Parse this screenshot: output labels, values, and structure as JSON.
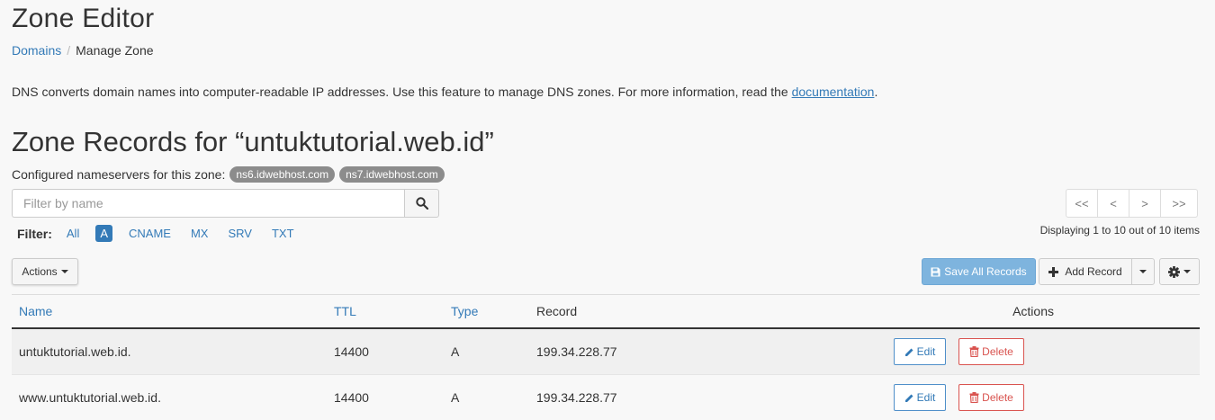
{
  "page": {
    "title": "Zone Editor",
    "breadcrumb": {
      "parent": "Domains",
      "separator": "/",
      "current": "Manage Zone"
    },
    "description": {
      "text": "DNS converts domain names into computer-readable IP addresses. Use this feature to manage DNS zones. For more information, read the ",
      "link": "documentation",
      "end": "."
    }
  },
  "zone": {
    "heading": "Zone Records for “untuktutorial.web.id”",
    "nameservers_label": "Configured nameservers for this zone:",
    "nameservers": [
      "ns6.idwebhost.com",
      "ns7.idwebhost.com"
    ]
  },
  "search": {
    "placeholder": "Filter by name",
    "icon": "search-icon"
  },
  "filter": {
    "label": "Filter:",
    "options": [
      "All",
      "A",
      "CNAME",
      "MX",
      "SRV",
      "TXT"
    ],
    "active": "A"
  },
  "pagination": {
    "buttons": [
      "<<",
      "<",
      ">",
      ">>"
    ],
    "info": "Displaying 1 to 10 out of 10 items"
  },
  "toolbar": {
    "actions_label": "Actions",
    "save_all_label": "Save All Records",
    "add_record_label": "Add Record",
    "settings_icon": "gear-icon"
  },
  "table": {
    "headers": {
      "name": "Name",
      "ttl": "TTL",
      "type": "Type",
      "record": "Record",
      "actions": "Actions"
    },
    "edit_label": "Edit",
    "delete_label": "Delete",
    "rows": [
      {
        "name": "untuktutorial.web.id.",
        "ttl": "14400",
        "type": "A",
        "record": "199.34.228.77"
      },
      {
        "name": "www.untuktutorial.web.id.",
        "ttl": "14400",
        "type": "A",
        "record": "199.34.228.77"
      }
    ]
  },
  "colors": {
    "link": "#337ab7",
    "primary_light": "#7eb4de",
    "danger": "#d9534f",
    "badge": "#8c8c8c"
  }
}
